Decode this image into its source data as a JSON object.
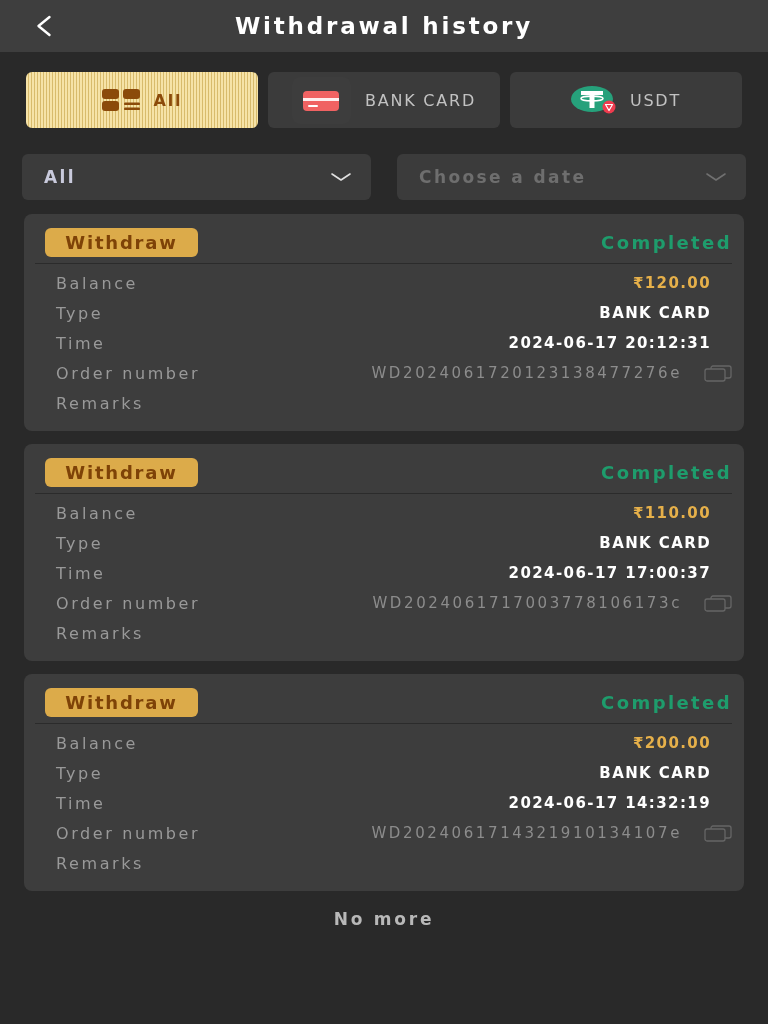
{
  "header": {
    "title": "Withdrawal history"
  },
  "tabs": [
    {
      "label": "All",
      "kind": "all",
      "selected": true
    },
    {
      "label": "BANK CARD",
      "kind": "bank_card",
      "selected": false
    },
    {
      "label": "USDT",
      "kind": "usdt",
      "selected": false
    }
  ],
  "filters": [
    {
      "kind": "status",
      "value": "All"
    },
    {
      "kind": "date",
      "placeholder": "Choose a date"
    }
  ],
  "records": [
    {
      "tag": "Withdraw",
      "status": "Completed",
      "fields": [
        {
          "kind": "amount",
          "label": "Balance",
          "value": "₹120.00"
        },
        {
          "kind": "text",
          "label": "Type",
          "value": "BANK CARD"
        },
        {
          "kind": "text",
          "label": "Time",
          "value": "2024-06-17 20:12:31"
        },
        {
          "kind": "order",
          "label": "Order number",
          "value": "WD2024061720123138477276e"
        },
        {
          "kind": "text",
          "label": "Remarks"
        }
      ]
    },
    {
      "tag": "Withdraw",
      "status": "Completed",
      "fields": [
        {
          "kind": "amount",
          "label": "Balance",
          "value": "₹110.00"
        },
        {
          "kind": "text",
          "label": "Type",
          "value": "BANK CARD"
        },
        {
          "kind": "text",
          "label": "Time",
          "value": "2024-06-17 17:00:37"
        },
        {
          "kind": "order",
          "label": "Order number",
          "value": "WD2024061717003778106173c"
        },
        {
          "kind": "text",
          "label": "Remarks"
        }
      ]
    },
    {
      "tag": "Withdraw",
      "status": "Completed",
      "fields": [
        {
          "kind": "amount",
          "label": "Balance",
          "value": "₹200.00"
        },
        {
          "kind": "text",
          "label": "Type",
          "value": "BANK CARD"
        },
        {
          "kind": "text",
          "label": "Time",
          "value": "2024-06-17 14:32:19"
        },
        {
          "kind": "order",
          "label": "Order number",
          "value": "WD2024061714321910134107e"
        },
        {
          "kind": "text",
          "label": "Remarks"
        }
      ]
    }
  ],
  "footer": {
    "text": "No more"
  }
}
